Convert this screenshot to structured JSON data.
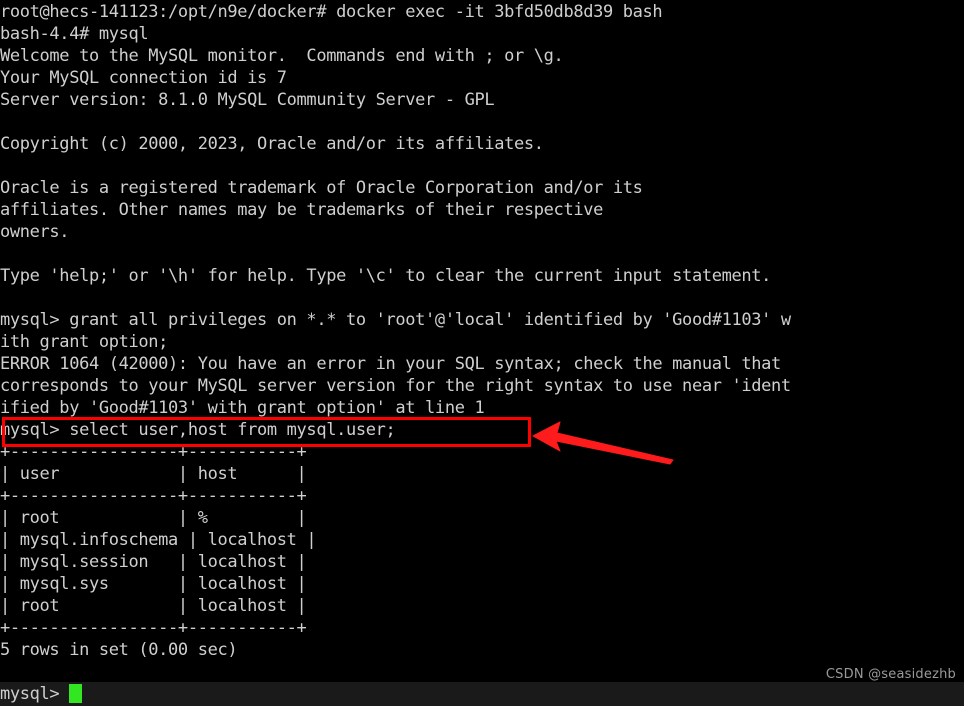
{
  "terminal": {
    "background_color": "#000000",
    "text_color": "#cfcfcf",
    "cursor_color": "#33e622",
    "annotation_color": "#fe0000",
    "lines": [
      "root@hecs-141123:/opt/n9e/docker# docker exec -it 3bfd50db8d39 bash",
      "bash-4.4# mysql",
      "Welcome to the MySQL monitor.  Commands end with ; or \\g.",
      "Your MySQL connection id is 7",
      "Server version: 8.1.0 MySQL Community Server - GPL",
      "",
      "Copyright (c) 2000, 2023, Oracle and/or its affiliates.",
      "",
      "Oracle is a registered trademark of Oracle Corporation and/or its",
      "affiliates. Other names may be trademarks of their respective",
      "owners.",
      "",
      "Type 'help;' or '\\h' for help. Type '\\c' to clear the current input statement.",
      "",
      "mysql> grant all privileges on *.* to 'root'@'local' identified by 'Good#1103' w",
      "ith grant option;",
      "ERROR 1064 (42000): You have an error in your SQL syntax; check the manual that",
      "corresponds to your MySQL server version for the right syntax to use near 'ident",
      "ified by 'Good#1103' with grant option' at line 1",
      "mysql> select user,host from mysql.user;",
      "+-----------------+-----------+",
      "| user            | host      |",
      "+-----------------+-----------+",
      "| root            | %         |",
      "| mysql.infoschema | localhost |",
      "| mysql.session   | localhost |",
      "| mysql.sys       | localhost |",
      "| root            | localhost |",
      "+-----------------+-----------+",
      "5 rows in set (0.00 sec)",
      ""
    ],
    "prompt": "mysql> ",
    "cursor": "block-cursor",
    "watermark": "CSDN @seasidezhb"
  },
  "highlighted_command": {
    "text": "mysql> select user,host from mysql.user;",
    "annotation": "red-rectangle-with-arrow"
  },
  "query_result": {
    "columns": [
      "user",
      "host"
    ],
    "rows": [
      [
        "root",
        "%"
      ],
      [
        "mysql.infoschema",
        "localhost"
      ],
      [
        "mysql.session",
        "localhost"
      ],
      [
        "mysql.sys",
        "localhost"
      ],
      [
        "root",
        "localhost"
      ]
    ],
    "status": "5 rows in set (0.00 sec)"
  },
  "session": {
    "host_prompt": "root@hecs-141123:/opt/n9e/docker#",
    "docker_command": "docker exec -it 3bfd50db8d39 bash",
    "container_prompt": "bash-4.4#",
    "mysql_command": "mysql",
    "mysql_version": "8.1.0 MySQL Community Server - GPL",
    "connection_id": "7",
    "error_code": "ERROR 1064 (42000)"
  }
}
